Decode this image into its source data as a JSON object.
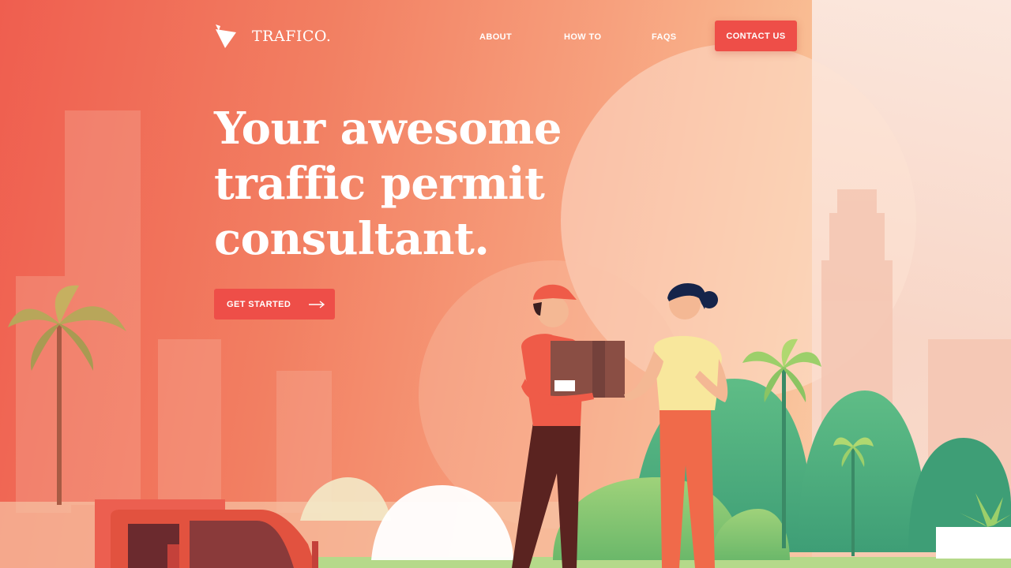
{
  "brand": {
    "name": "TRAFICO."
  },
  "nav": {
    "items": [
      "ABOUT",
      "HOW TO",
      "FAQS"
    ],
    "contact_label": "CONTACT US"
  },
  "hero": {
    "headline": [
      "Your awesome",
      "traffic permit",
      "consultant."
    ],
    "cta_label": "GET STARTED"
  },
  "colors": {
    "accent": "#ee4e48",
    "background_start": "#ef5e4f",
    "background_end": "#fbe1cf"
  },
  "icons": {
    "logo": "logo-mark-icon",
    "cta": "arrow-right-icon"
  }
}
